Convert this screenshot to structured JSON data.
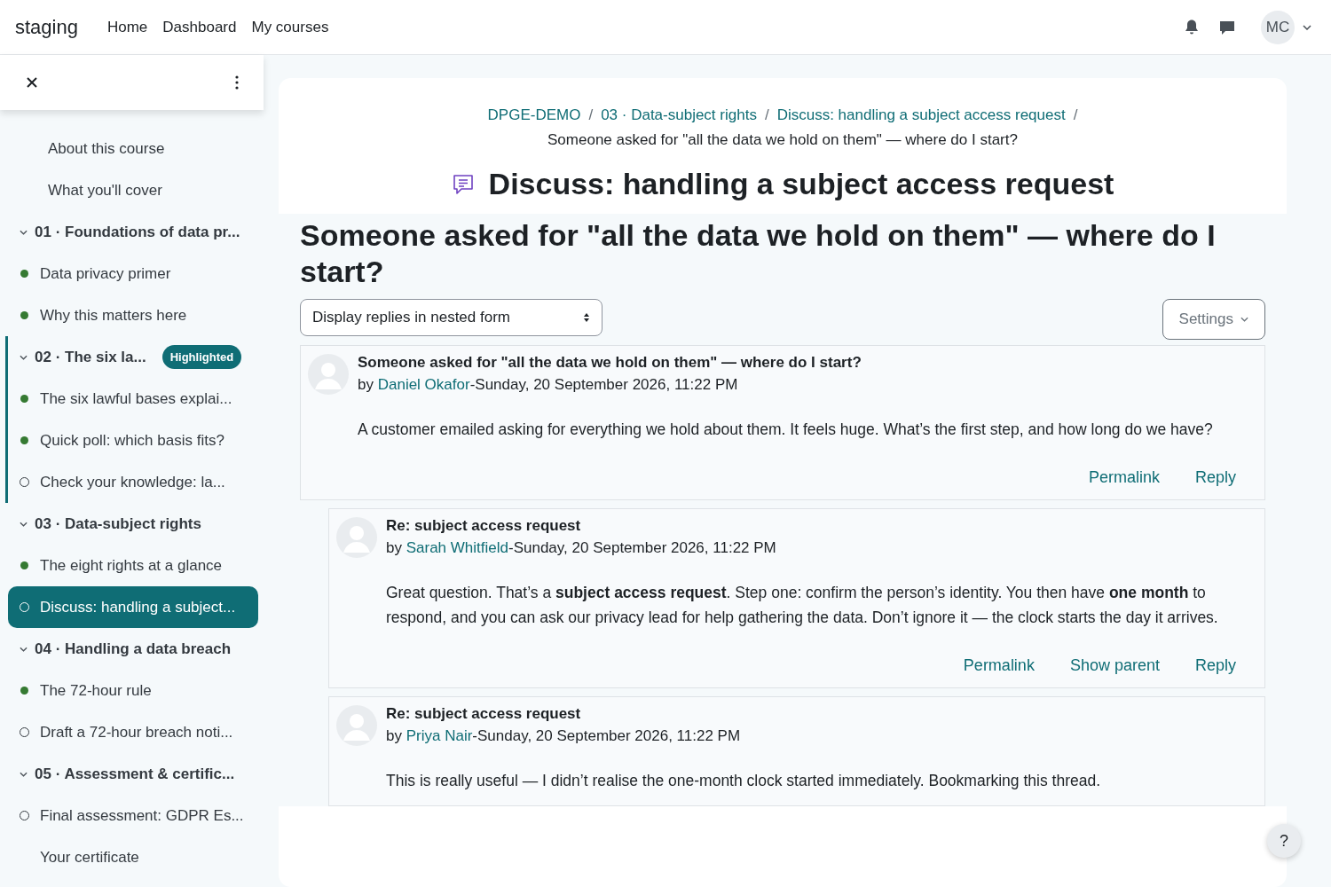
{
  "navbar": {
    "brand": "staging",
    "links": [
      "Home",
      "Dashboard",
      "My courses"
    ],
    "user_initials": "MC"
  },
  "sidebar": {
    "items": [
      {
        "kind": "page",
        "label": "About this course",
        "selected": false
      },
      {
        "kind": "page",
        "label": "What you'll cover",
        "selected": false
      },
      {
        "kind": "section",
        "label": "01 · Foundations of data pr...",
        "expanded": true,
        "highlighted": false,
        "children": [
          {
            "kind": "activity",
            "label": "Data privacy primer",
            "completed": true,
            "selected": false
          },
          {
            "kind": "activity",
            "label": "Why this matters here",
            "completed": true,
            "selected": false
          }
        ]
      },
      {
        "kind": "section",
        "label": "02 · The six la...",
        "expanded": true,
        "highlighted": true,
        "badge": "Highlighted",
        "children": [
          {
            "kind": "activity",
            "label": "The six lawful bases explai...",
            "completed": true,
            "selected": false
          },
          {
            "kind": "activity",
            "label": "Quick poll: which basis fits?",
            "completed": true,
            "selected": false
          },
          {
            "kind": "activity",
            "label": "Check your knowledge: la...",
            "completed": false,
            "selected": false
          }
        ]
      },
      {
        "kind": "section",
        "label": "03 · Data-subject rights",
        "expanded": true,
        "highlighted": false,
        "children": [
          {
            "kind": "activity",
            "label": "The eight rights at a glance",
            "completed": true,
            "selected": false
          },
          {
            "kind": "activity",
            "label": "Discuss: handling a subject...",
            "completed": false,
            "selected": true
          }
        ]
      },
      {
        "kind": "section",
        "label": "04 · Handling a data breach",
        "expanded": true,
        "highlighted": false,
        "children": [
          {
            "kind": "activity",
            "label": "The 72-hour rule",
            "completed": true,
            "selected": false
          },
          {
            "kind": "activity",
            "label": "Draft a 72-hour breach noti...",
            "completed": false,
            "selected": false
          }
        ]
      },
      {
        "kind": "section",
        "label": "05 · Assessment & certific...",
        "expanded": true,
        "highlighted": false,
        "children": [
          {
            "kind": "activity",
            "label": "Final assessment: GDPR Es...",
            "completed": false,
            "selected": false
          },
          {
            "kind": "page",
            "label": "Your certificate",
            "selected": false
          }
        ]
      }
    ]
  },
  "breadcrumb": [
    {
      "label": "DPGE-DEMO"
    },
    {
      "separator": "/",
      "label": "03 · Data-subject rights"
    },
    {
      "separator": "/",
      "label": "Discuss: handling a subject access request"
    },
    {
      "separator": "/",
      "label": "Someone asked for \"all the data we hold on them\" — where do I start?"
    }
  ],
  "page_title": "Discuss: handling a subject access request",
  "discussion_title": "Someone asked for \"all the data we hold on them\" — where do I start?",
  "display_mode": {
    "value": "Display replies in nested form"
  },
  "settings_button": "Settings",
  "posts": [
    {
      "subject": "Someone asked for \"all the data we hold on them\" — where do I start?",
      "by": "by",
      "author": "Daniel Okafor",
      "separator": "-",
      "date": "Sunday, 20 September 2026, 11:22 PM",
      "body": "A customer emailed asking for everything we hold about them. It feels huge. What’s the first step, and how long do we have?",
      "actions": [
        "Permalink",
        "Reply"
      ],
      "children": [
        {
          "subject": "Re: subject access request",
          "by": "by",
          "author": "Sarah Whitfield",
          "separator": "-",
          "date": "Sunday, 20 September 2026, 11:22 PM",
          "body": "Great question. That’s a **subject access request**. Step one: confirm the person’s identity. You then have **one month** to respond, and you can ask our privacy lead for help gathering the data. Don’t ignore it — the clock starts the day it arrives.",
          "actions": [
            "Permalink",
            "Show parent",
            "Reply"
          ]
        },
        {
          "subject": "Re: subject access request",
          "by": "by",
          "author": "Priya Nair",
          "separator": "-",
          "date": "Sunday, 20 September 2026, 11:22 PM",
          "body": "This is really useful — I didn’t realise the one-month clock started immediately. Bookmarking this thread."
        }
      ]
    }
  ],
  "help_button": "?"
}
